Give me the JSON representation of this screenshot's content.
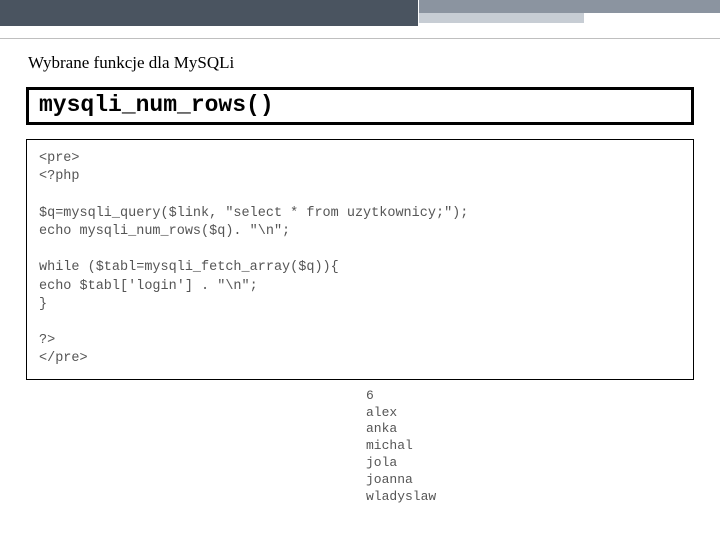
{
  "section_title": "Wybrane funkcje dla MySQLi",
  "heading": "mysqli_num_rows()",
  "code": "<pre>\n<?php\n\n$q=mysqli_query($link, \"select * from uzytkownicy;\");\necho mysqli_num_rows($q). \"\\n\";\n\nwhile ($tabl=mysqli_fetch_array($q)){\necho $tabl['login'] . \"\\n\";\n}\n\n?>\n</pre>",
  "output": "6\nalex\nanka\nmichal\njola\njoanna\nwladyslaw"
}
